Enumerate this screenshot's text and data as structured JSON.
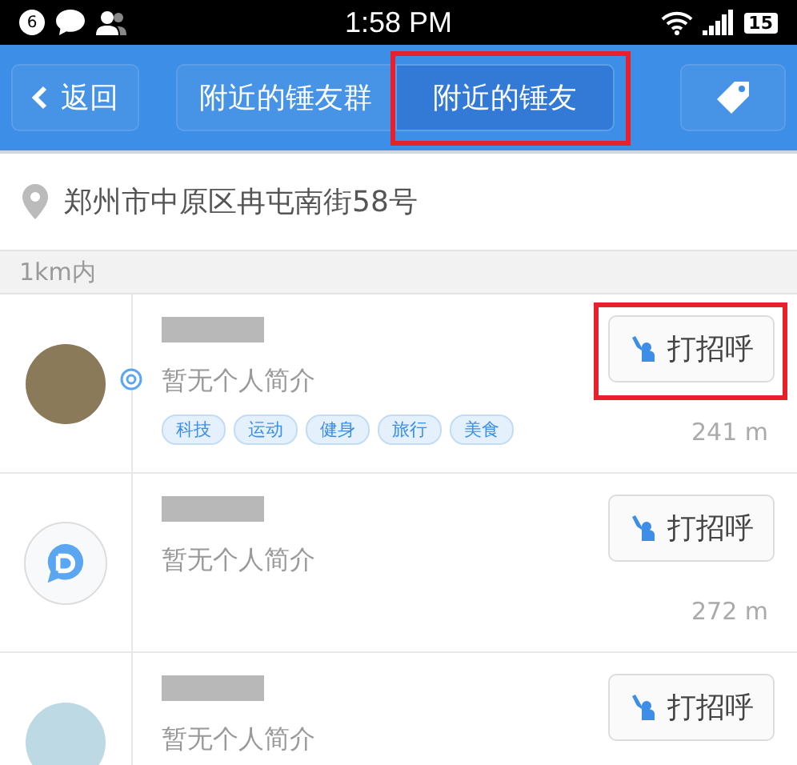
{
  "status_bar": {
    "notification_count": "6",
    "time": "1:58 PM",
    "battery": "15"
  },
  "nav": {
    "back": "返回",
    "tabs": [
      {
        "label": "附近的锤友群",
        "selected": false,
        "highlighted": false
      },
      {
        "label": "附近的锤友",
        "selected": true,
        "highlighted": true
      }
    ]
  },
  "location": "郑州市中原区冉屯南街58号",
  "section": "1km内",
  "people": [
    {
      "kind": "photo",
      "verified": true,
      "bio": "暂无个人简介",
      "tags": [
        "科技",
        "运动",
        "健身",
        "旅行",
        "美食"
      ],
      "greet": "打招呼",
      "greet_highlighted": true,
      "distance": "241 m"
    },
    {
      "kind": "default",
      "verified": false,
      "bio": "暂无个人简介",
      "greet": "打招呼",
      "greet_highlighted": false,
      "distance": "272 m"
    },
    {
      "kind": "photo",
      "verified": false,
      "bio": "暂无个人简介",
      "greet": "打招呼",
      "greet_highlighted": false
    }
  ]
}
